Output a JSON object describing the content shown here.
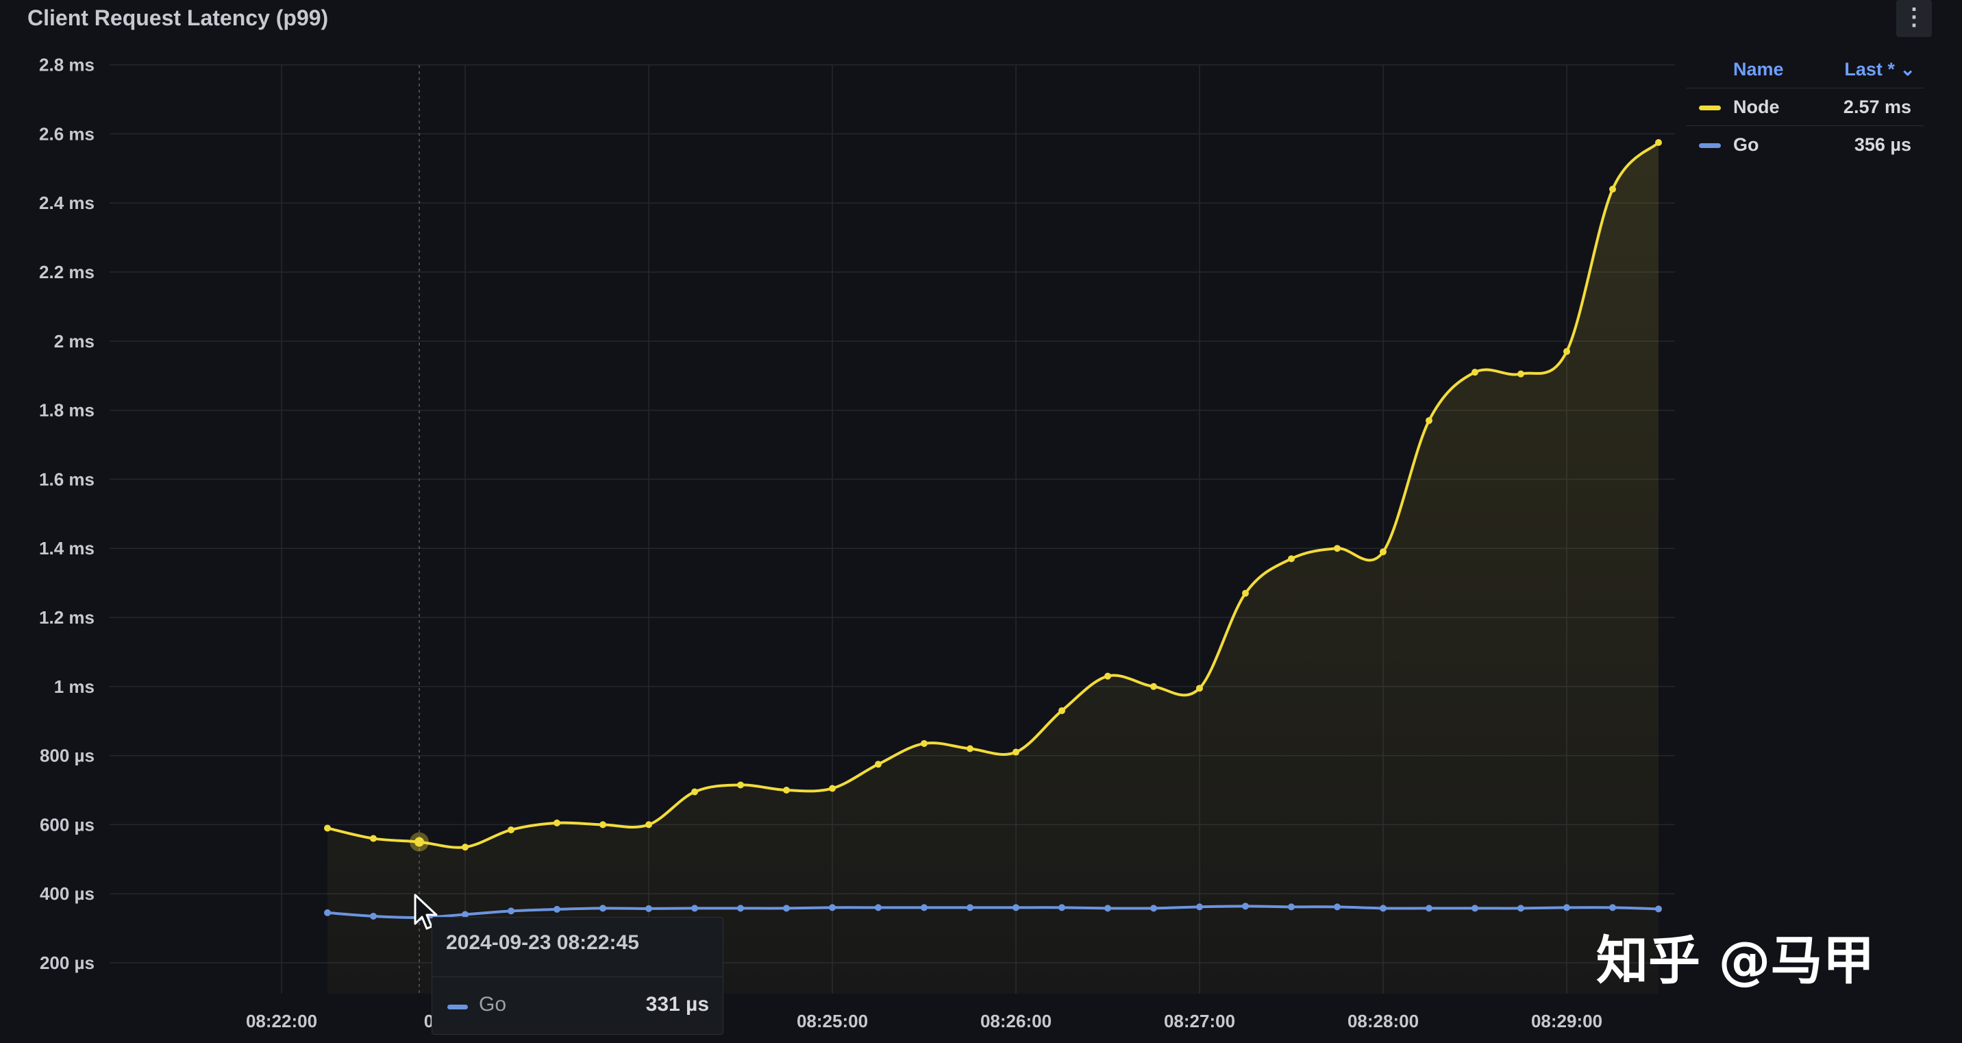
{
  "panel": {
    "title": "Client Request Latency (p99)",
    "menu_icon": "more-vertical-icon"
  },
  "legend": {
    "col_name": "Name",
    "col_last": "Last * ⌄",
    "items": [
      {
        "name": "Node",
        "last": "2.57 ms",
        "color": "#f2dc3c"
      },
      {
        "name": "Go",
        "last": "356 µs",
        "color": "#6c95e0"
      }
    ]
  },
  "tooltip": {
    "time": "2024-09-23 08:22:45",
    "series": "Go",
    "value": "331 µs"
  },
  "watermark": {
    "label": "知乎 @马甲"
  },
  "cursor_icon": "mouse-pointer-icon",
  "chart_data": {
    "type": "line",
    "y_unit": "ms",
    "ylim": [
      0.13,
      2.83
    ],
    "y_ticks": [
      {
        "value": 0.2,
        "label": "200 µs"
      },
      {
        "value": 0.4,
        "label": "400 µs"
      },
      {
        "value": 0.6,
        "label": "600 µs"
      },
      {
        "value": 0.8,
        "label": "800 µs"
      },
      {
        "value": 1.0,
        "label": "1 ms"
      },
      {
        "value": 1.2,
        "label": "1.2 ms"
      },
      {
        "value": 1.4,
        "label": "1.4 ms"
      },
      {
        "value": 1.6,
        "label": "1.6 ms"
      },
      {
        "value": 1.8,
        "label": "1.8 ms"
      },
      {
        "value": 2.0,
        "label": "2 ms"
      },
      {
        "value": 2.2,
        "label": "2.2 ms"
      },
      {
        "value": 2.4,
        "label": "2.4 ms"
      },
      {
        "value": 2.6,
        "label": "2.6 ms"
      },
      {
        "value": 2.8,
        "label": "2.8 ms"
      }
    ],
    "x_ticks": [
      "08:22:00",
      "08:23:00",
      "08:24:00",
      "08:25:00",
      "08:26:00",
      "08:27:00",
      "08:28:00",
      "08:29:00"
    ],
    "x_ticks_visible": [
      true,
      false,
      false,
      true,
      true,
      true,
      true,
      true
    ],
    "x_partial_label": "0",
    "x": [
      "08:22:15",
      "08:22:30",
      "08:22:45",
      "08:23:00",
      "08:23:15",
      "08:23:30",
      "08:23:45",
      "08:24:00",
      "08:24:15",
      "08:24:30",
      "08:24:45",
      "08:25:00",
      "08:25:15",
      "08:25:30",
      "08:25:45",
      "08:26:00",
      "08:26:15",
      "08:26:30",
      "08:26:45",
      "08:27:00",
      "08:27:15",
      "08:27:30",
      "08:27:45",
      "08:28:00",
      "08:28:15",
      "08:28:30",
      "08:28:45",
      "08:29:00",
      "08:29:15",
      "08:29:30"
    ],
    "series": [
      {
        "name": "Node",
        "color": "#f2dc3c",
        "values": [
          0.59,
          0.56,
          0.55,
          0.535,
          0.585,
          0.605,
          0.6,
          0.6,
          0.695,
          0.715,
          0.7,
          0.705,
          0.775,
          0.835,
          0.82,
          0.81,
          0.93,
          1.03,
          1.0,
          0.995,
          1.27,
          1.37,
          1.4,
          1.39,
          1.77,
          1.91,
          1.905,
          1.97,
          2.44,
          2.575
        ]
      },
      {
        "name": "Go",
        "color": "#6c95e0",
        "values": [
          0.345,
          0.335,
          0.331,
          0.34,
          0.35,
          0.355,
          0.358,
          0.357,
          0.358,
          0.358,
          0.358,
          0.36,
          0.36,
          0.36,
          0.36,
          0.36,
          0.36,
          0.358,
          0.358,
          0.362,
          0.364,
          0.362,
          0.362,
          0.358,
          0.358,
          0.358,
          0.358,
          0.36,
          0.36,
          0.356
        ]
      }
    ],
    "hover_x": "08:22:45",
    "grid": true
  }
}
